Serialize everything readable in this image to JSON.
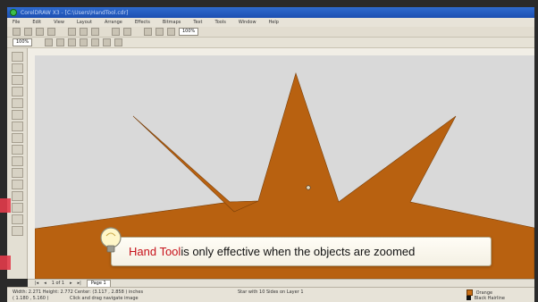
{
  "window": {
    "title": "CorelDRAW X3 - [C:\\Users\\HandTool.cdr]"
  },
  "menu": [
    "File",
    "Edit",
    "View",
    "Layout",
    "Arrange",
    "Effects",
    "Bitmaps",
    "Text",
    "Tools",
    "Window",
    "Help"
  ],
  "toolbar": {
    "zoom_value": "100%",
    "zoom_value_2": "100%"
  },
  "document": {
    "page_count": "1 of 1",
    "page_tab": "Page 1"
  },
  "status": {
    "line1_left": "Width: 2.271  Height: 2.772  Center: (3.117 , 2.858 )  inches",
    "line1_mid": "Star with 10 Sides on Layer 1",
    "line2_left": "( 1.180 , 5.160 )",
    "line2_mid": "Click and drag navigate image",
    "fill_label": "Orange",
    "outline_label": "Black  Hairline"
  },
  "callout": {
    "accent": "Hand Tool",
    "text": " is only effective when the objects are zoomed"
  },
  "colors": {
    "shape_fill": "#b86110",
    "canvas_bg": "#d9d9d9",
    "accent_red": "#c6111a"
  },
  "icons": [
    "app-icon",
    "lightbulb-icon",
    "cursor-icon"
  ]
}
